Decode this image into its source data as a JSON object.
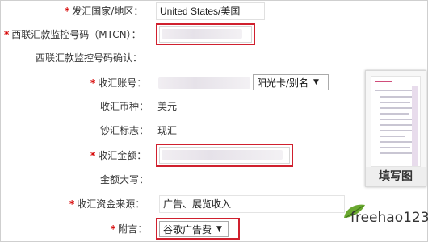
{
  "form": {
    "country": {
      "label": "发汇国家/地区",
      "value": "United States/美国"
    },
    "mtcn": {
      "label": "西联汇款监控号码（MTCN）",
      "value": ""
    },
    "mtcn_confirm": {
      "label": "西联汇款监控号码确认",
      "value": ""
    },
    "account": {
      "label": "收汇账号",
      "select_value": "阳光卡/别名"
    },
    "currency": {
      "label": "收汇币种",
      "value": "美元"
    },
    "cash_flag": {
      "label": "钞汇标志",
      "value": "现汇"
    },
    "amount": {
      "label": "收汇金额",
      "value": ""
    },
    "amount_upper": {
      "label": "金额大写",
      "value": ""
    },
    "source": {
      "label": "收汇资金来源",
      "value": "广告、展览收入"
    },
    "note": {
      "label": "附言",
      "select_value": "谷歌广告费"
    }
  },
  "side_thumbnail": {
    "caption": "填写图"
  },
  "watermark": {
    "text": "freehao123",
    "icon": "leaf-icon"
  },
  "colors": {
    "required": "#d60000",
    "highlight": "#d0202e",
    "leaf_green": "#6aa830"
  }
}
